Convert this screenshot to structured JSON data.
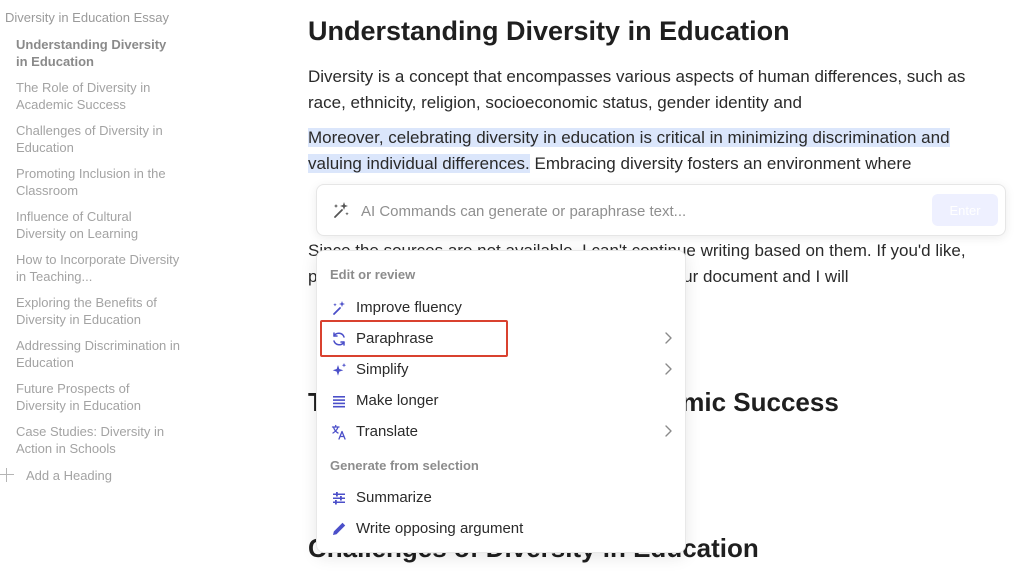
{
  "sidebar": {
    "doc_title": "Diversity in Education Essay",
    "items": [
      {
        "label": "Understanding Diversity in Education",
        "active": true
      },
      {
        "label": "The Role of Diversity in Academic Success"
      },
      {
        "label": "Challenges of Diversity in Education"
      },
      {
        "label": "Promoting Inclusion in the Classroom"
      },
      {
        "label": "Influence of Cultural Diversity on Learning"
      },
      {
        "label": "How to Incorporate Diversity in Teaching..."
      },
      {
        "label": "Exploring the Benefits of Diversity in Education"
      },
      {
        "label": "Addressing Discrimination in Education"
      },
      {
        "label": "Future Prospects of Diversity in Education"
      },
      {
        "label": "Case Studies: Diversity in Action in Schools"
      }
    ],
    "add_heading": "Add a Heading"
  },
  "document": {
    "title": "Understanding Diversity in Education",
    "paragraph1": "Diversity is a concept that encompasses various aspects of human differences, such as race, ethnicity, religion, socioeconomic status, gender identity and",
    "paragraph2_selected": "Moreover, celebrating diversity in education is critical in minimizing discrimination and valuing individual differences.",
    "paragraph2_rest": " Embracing diversity fosters an environment where",
    "paragraph3": "Since the sources are not available, I can't continue writing based on them. If you'd like, please provide key points or ideas to include in your document and I will",
    "heading2": "The Role of Diversity in Academic Success",
    "heading3": "Challenges of Diversity in Education"
  },
  "ai_bar": {
    "placeholder": "AI Commands can generate or paraphrase text...",
    "enter_label": "Enter",
    "icon": "sparkle-icon"
  },
  "menu": {
    "section1_label": "Edit or review",
    "section2_label": "Generate from selection",
    "items": [
      {
        "label": "Improve fluency",
        "icon": "magic-wand-icon"
      },
      {
        "label": "Paraphrase",
        "icon": "refresh-icon",
        "has_submenu": true,
        "highlighted": true
      },
      {
        "label": "Simplify",
        "icon": "sparkles-icon",
        "has_submenu": true
      },
      {
        "label": "Make longer",
        "icon": "lines-icon"
      },
      {
        "label": "Translate",
        "icon": "translate-icon",
        "has_submenu": true
      },
      {
        "label": "Summarize",
        "icon": "sliders-icon"
      },
      {
        "label": "Write opposing argument",
        "icon": "pencil-icon"
      }
    ]
  },
  "colors": {
    "accent": "#4b4fc9",
    "selection": "#dbe6fb",
    "highlight_border": "#d9412f"
  }
}
